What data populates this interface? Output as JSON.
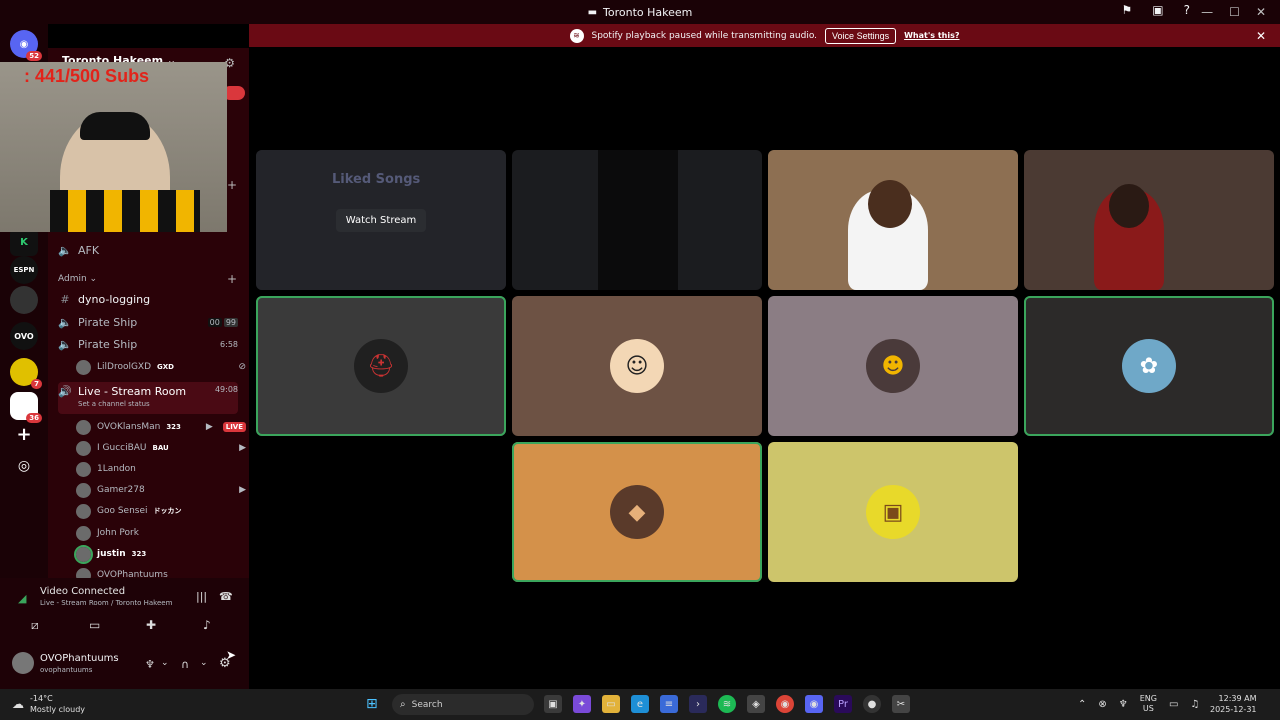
{
  "window": {
    "title": "Toronto Hakeem"
  },
  "banner": {
    "message": "Spotify playback paused while transmitting audio.",
    "voice_settings": "Voice Settings",
    "whats_this": "What's this?"
  },
  "servers": {
    "home_badge": "52",
    "badge_2": "7",
    "badge_3": "36"
  },
  "overlay": {
    "subs_text": ": 441/500  Subs"
  },
  "sidebar": {
    "server_name": "Toronto Hakeem",
    "afk": "AFK",
    "admin_category": "Admin",
    "dyno_logging": "dyno-logging",
    "pirate_ship_1": {
      "name": "Pirate Ship",
      "count_a": "00",
      "count_b": "99"
    },
    "pirate_ship_2": {
      "name": "Pirate Ship",
      "time": "6:58"
    },
    "pirate_member": {
      "name": "LilDroolGXD",
      "tag": "GXD"
    },
    "live_room": {
      "name": "Live - Stream Room",
      "time": "49:08",
      "status": "Set a channel status"
    },
    "members": [
      {
        "name": "OVOKlansMan",
        "tag": "323",
        "live": "LIVE"
      },
      {
        "name": "I GucciBAU",
        "tag": "BAU"
      },
      {
        "name": "1Landon"
      },
      {
        "name": "Gamer278"
      },
      {
        "name": "Goo Sensei",
        "tag": "ドッカン"
      },
      {
        "name": "John Pork"
      },
      {
        "name": "justin",
        "tag": "323"
      },
      {
        "name": "OVOPhantuums"
      }
    ]
  },
  "voice": {
    "status": "Video Connected",
    "location": "Live - Stream Room / Toronto Hakeem"
  },
  "user": {
    "display_name": "OVOPhantuums",
    "username": "ovophantuums"
  },
  "stage": {
    "watch_stream": "Watch Stream",
    "stream_preview_title": "Liked Songs"
  },
  "taskbar": {
    "weather_temp": "-14°C",
    "weather_desc": "Mostly cloudy",
    "search_placeholder": "Search",
    "lang": "ENG",
    "region": "US",
    "time": "12:39 AM",
    "date": "2025-12-31"
  }
}
